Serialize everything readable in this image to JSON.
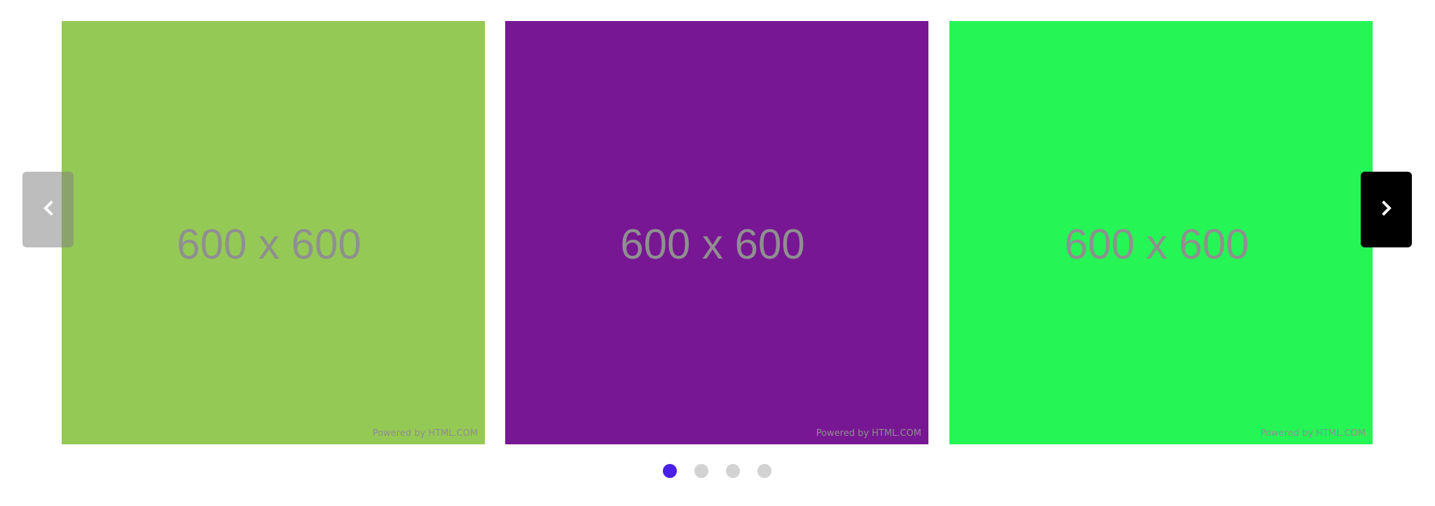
{
  "carousel": {
    "slides": [
      {
        "text": "600 x 600",
        "footer": "Powered by HTML.COM",
        "color": "#95c955"
      },
      {
        "text": "600 x 600",
        "footer": "Powered by HTML.COM",
        "color": "#781793"
      },
      {
        "text": "600 x 600",
        "footer": "Powered by HTML.COM",
        "color": "#26f556"
      }
    ],
    "prev_icon": "chevron-left-icon",
    "next_icon": "chevron-right-icon",
    "active_dot_color": "#4a1fe6",
    "inactive_dot_color": "#d2d2d2",
    "dot_count": 4,
    "active_dot_index": 0
  }
}
